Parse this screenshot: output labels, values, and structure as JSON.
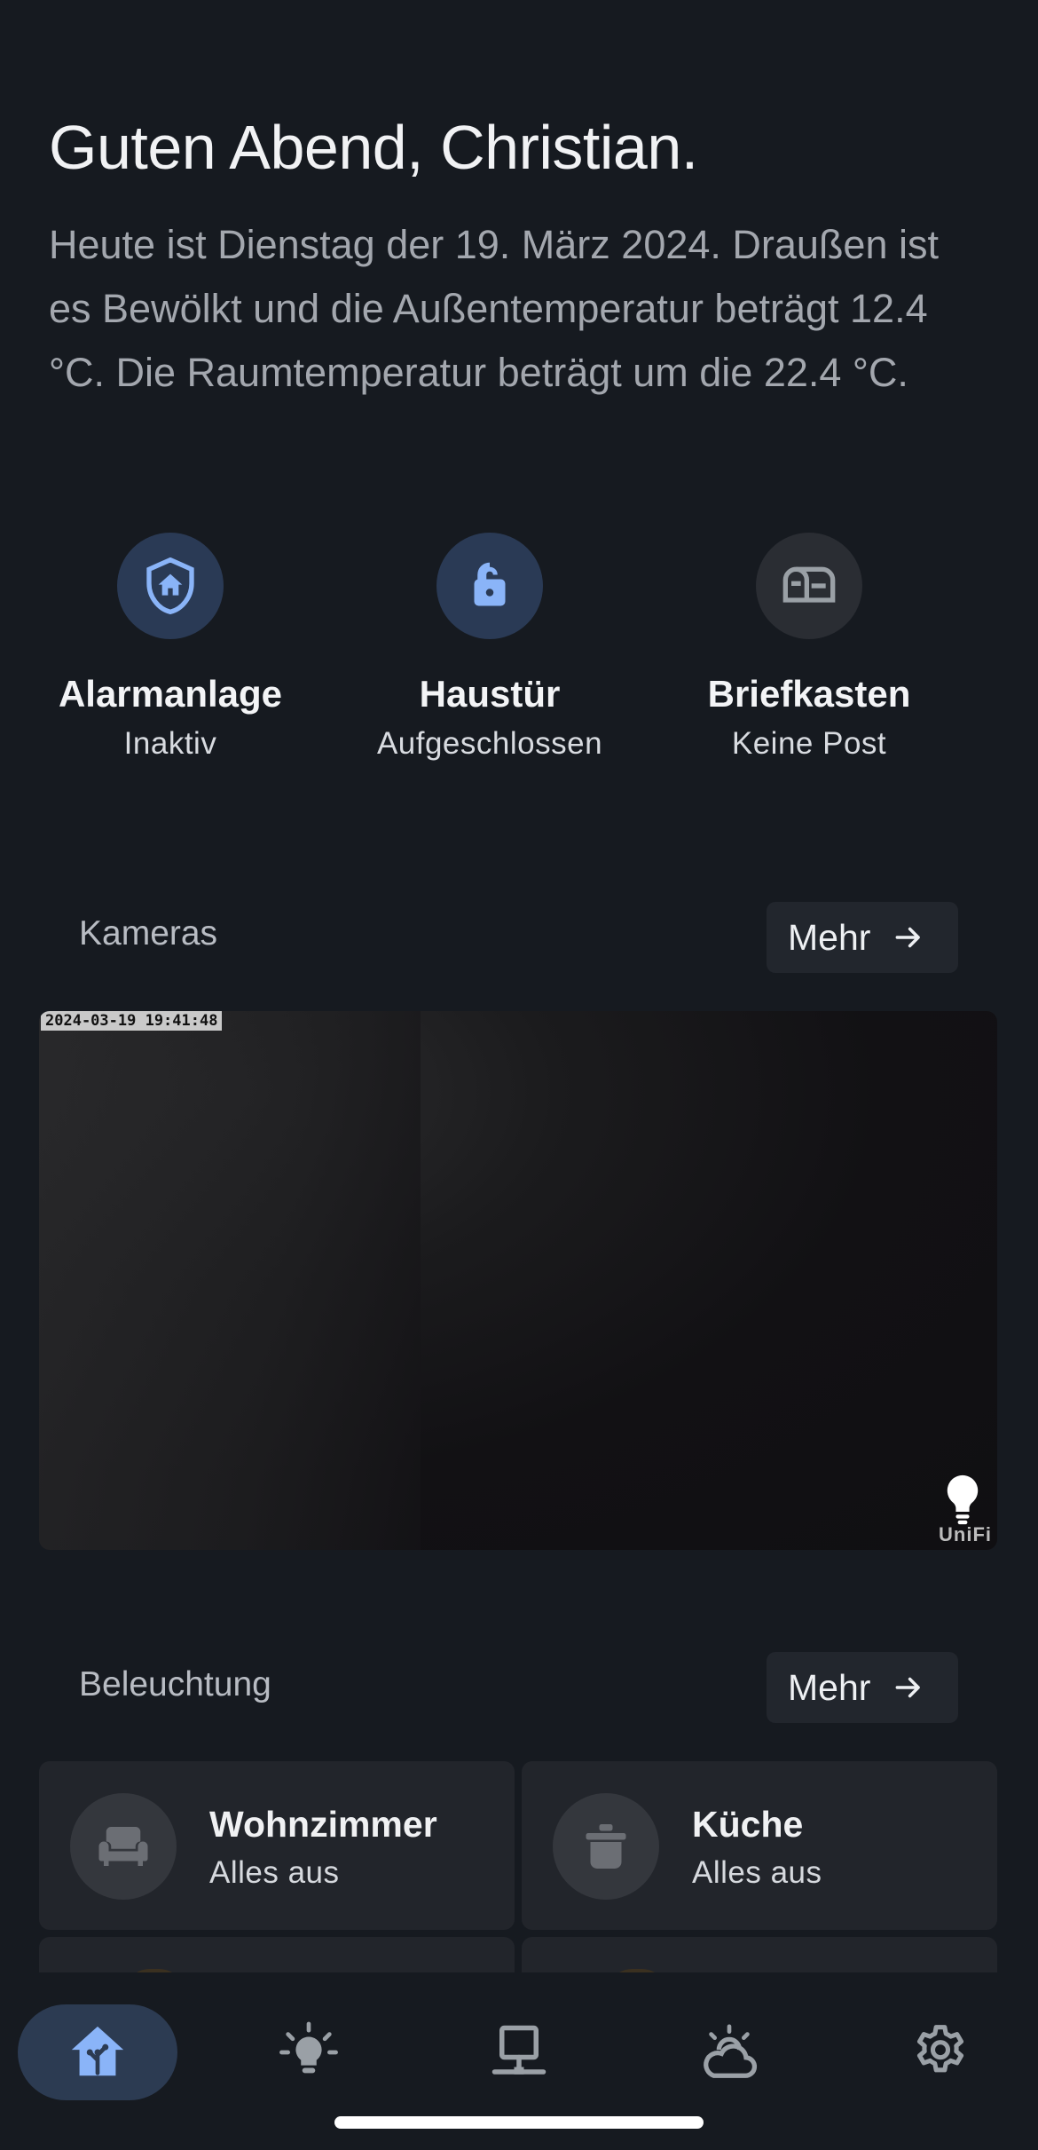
{
  "greeting": "Guten Abend, Christian.",
  "summary": "Heute ist Dienstag der 19. März 2024. Draußen ist es Bewölkt und die Außentemperatur beträgt 12.4 °C. Die Raumtemperatur beträgt um die 22.4 °C.",
  "status_tiles": [
    {
      "title": "Alarmanlage",
      "sub": "Inaktiv",
      "icon": "shield-home-icon",
      "color": "#8ab4f8"
    },
    {
      "title": "Haustür",
      "sub": "Aufgeschlossen",
      "icon": "lock-open-icon",
      "color": "#8ab4f8"
    },
    {
      "title": "Briefkasten",
      "sub": "Keine Post",
      "icon": "mailbox-icon",
      "color": "#9aa0a6"
    }
  ],
  "cameras": {
    "title": "Kameras",
    "more": "Mehr",
    "timestamp": "2024-03-19 19:41:48",
    "brand": "UniFi"
  },
  "lighting": {
    "title": "Beleuchtung",
    "more": "Mehr",
    "rooms": [
      {
        "name": "Wohnzimmer",
        "state": "Alles aus",
        "icon": "sofa-icon"
      },
      {
        "name": "Küche",
        "state": "Alles aus",
        "icon": "pot-icon"
      }
    ]
  },
  "nav": [
    "home-icon",
    "lightbulb-icon",
    "network-icon",
    "weather-icon",
    "settings-icon"
  ],
  "colors": {
    "background": "#161a20",
    "accent": "#8ab4f8",
    "card": "#22252b"
  }
}
